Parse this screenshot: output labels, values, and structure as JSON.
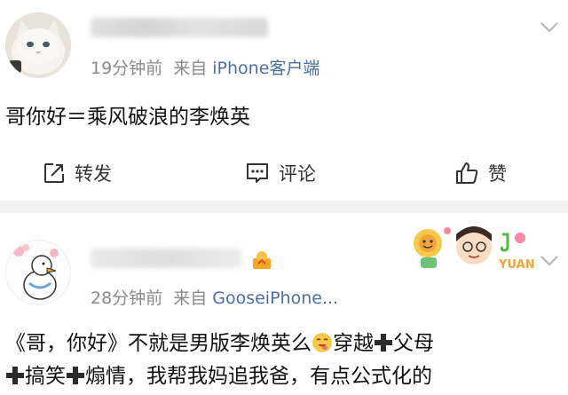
{
  "posts": [
    {
      "time": "19分钟前",
      "source_prefix": "来自",
      "source": "iPhone客户端",
      "text": "哥你好＝乘风破浪的李焕英",
      "actions": {
        "repost": "转发",
        "comment": "评论",
        "like": "赞"
      }
    },
    {
      "time": "28分钟前",
      "source_prefix": "来自",
      "source": "GooseiPhone...",
      "text_parts": [
        "《哥，你好》不就是男版李焕英么",
        "穿越",
        "父母",
        "搞笑",
        "煽情，我帮我妈追我爸，有点公式化的"
      ]
    }
  ],
  "icons": [
    "repost-icon",
    "comment-icon",
    "like-icon",
    "chevron-down-icon",
    "plus-icon",
    "emoji-icon"
  ],
  "colors": {
    "source_link": "#4a6fa5",
    "meta": "#8a8a8a",
    "divider": "#f2f2f2"
  }
}
